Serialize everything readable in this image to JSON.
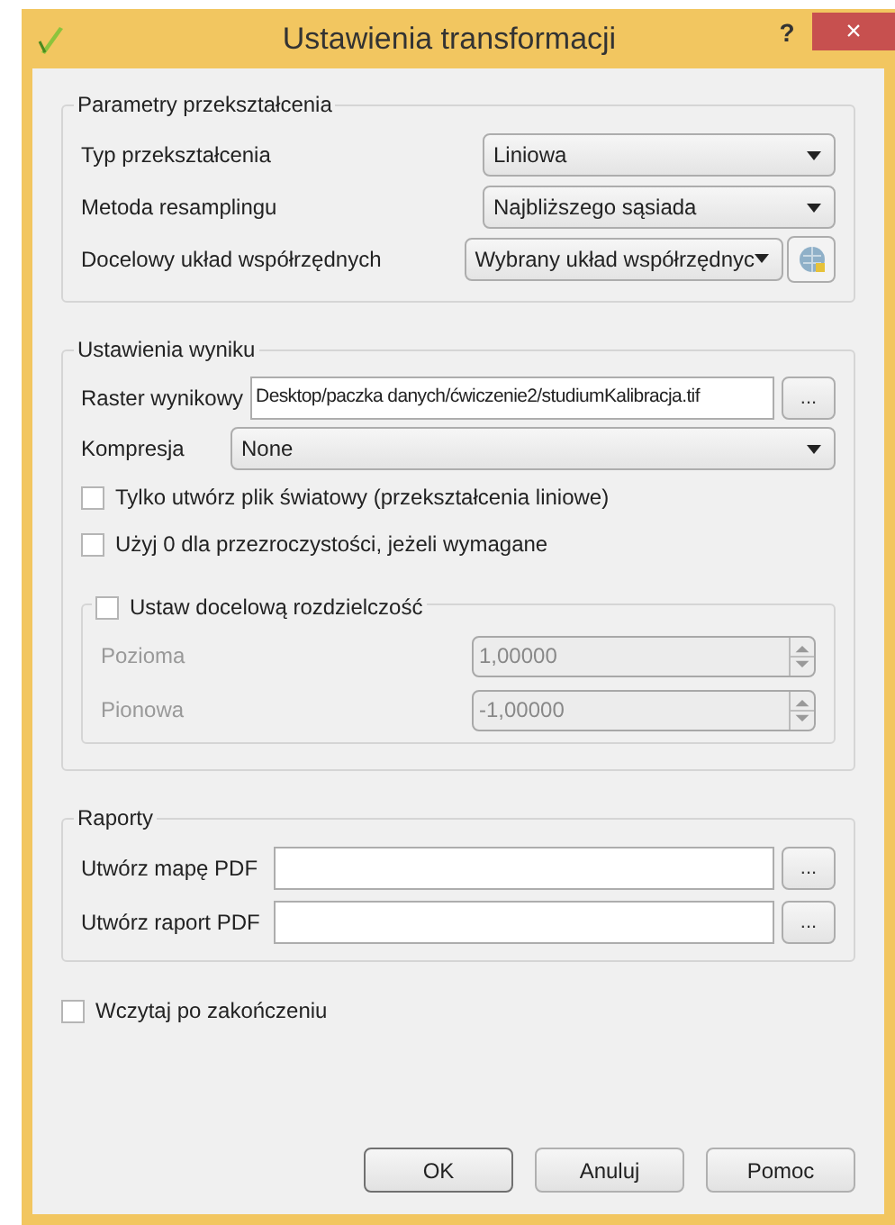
{
  "window": {
    "title": "Ustawienia transformacji",
    "help": "?",
    "close": "×"
  },
  "transform_group": {
    "title": "Parametry przekształcenia",
    "rows": [
      {
        "label": "Typ przekształcenia",
        "value": "Liniowa",
        "has_button": false
      },
      {
        "label": "Metoda resamplingu",
        "value": "Najbliższego sąsiada",
        "has_button": false
      },
      {
        "label": "Docelowy układ współrzędnych",
        "value": "Wybrany układ współrzędnyc",
        "has_button": true
      }
    ]
  },
  "output_group": {
    "title": "Ustawienia wyniku",
    "raster": {
      "label": "Raster wynikowy",
      "value": "Desktop/paczka danych/ćwiczenie2/studiumKalibracja.tif",
      "browse": "..."
    },
    "compression": {
      "label": "Kompresja",
      "value": "None"
    },
    "checkboxes": [
      {
        "label": "Tylko utwórz plik światowy (przekształcenia liniowe)",
        "checked": false
      },
      {
        "label": "Użyj 0 dla przezroczystości, jeżeli wymagane",
        "checked": false
      }
    ],
    "resolution": {
      "label": "Ustaw docelową rozdzielczość",
      "checked": false,
      "fields": [
        {
          "label": "Pozioma",
          "value": "1,00000",
          "disabled": true
        },
        {
          "label": "Pionowa",
          "value": "-1,00000",
          "disabled": true
        }
      ]
    }
  },
  "reports_group": {
    "title": "Raporty",
    "rows": [
      {
        "label": "Utwórz mapę PDF",
        "value": "",
        "browse": "..."
      },
      {
        "label": "Utwórz raport PDF",
        "value": "",
        "browse": "..."
      }
    ]
  },
  "load_when_done": {
    "label": "Wczytaj po zakończeniu",
    "checked": false
  },
  "buttons": [
    {
      "label": "OK",
      "default": true
    },
    {
      "label": "Anuluj",
      "default": false
    },
    {
      "label": "Pomoc",
      "default": false
    }
  ]
}
